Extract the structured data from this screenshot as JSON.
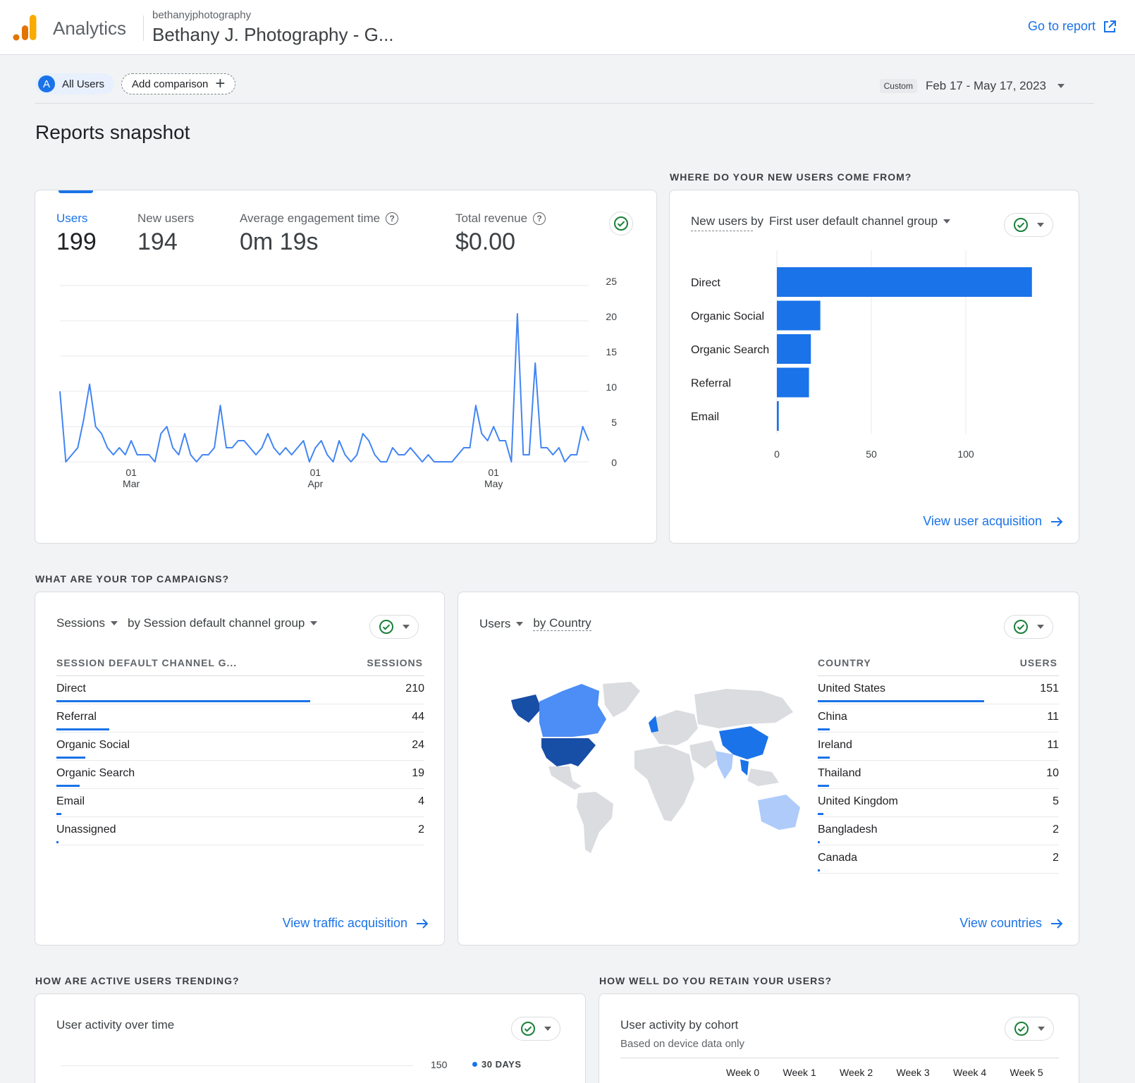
{
  "header": {
    "app_name": "Analytics",
    "account": "bethanyjphotography",
    "property": "Bethany J. Photography - G...",
    "go_to_report": "Go to report"
  },
  "toolbar": {
    "segment_avatar": "A",
    "segment_label": "All Users",
    "add_comparison": "Add comparison",
    "date_tag": "Custom",
    "date_range": "Feb 17 - May 17, 2023"
  },
  "page_title": "Reports snapshot",
  "overview": {
    "metrics": [
      {
        "label": "Users",
        "value": "199"
      },
      {
        "label": "New users",
        "value": "194"
      },
      {
        "label": "Average engagement time",
        "value": "0m 19s"
      },
      {
        "label": "Total revenue",
        "value": "$0.00"
      }
    ],
    "y_ticks": [
      "25",
      "20",
      "15",
      "10",
      "5",
      "0"
    ],
    "x_ticks": [
      {
        "day": "01",
        "month": "Mar"
      },
      {
        "day": "01",
        "month": "Apr"
      },
      {
        "day": "01",
        "month": "May"
      }
    ],
    "colors": {
      "line": "#4285f4"
    }
  },
  "new_users": {
    "section": "WHERE DO YOUR NEW USERS COME FROM?",
    "title_metric": "New users by",
    "title_dim": "First user default channel group",
    "link": "View user acquisition",
    "x_ticks": [
      "0",
      "50",
      "100"
    ]
  },
  "campaigns": {
    "section": "WHAT ARE YOUR TOP CAMPAIGNS?",
    "title_metric": "Sessions",
    "title_dim": "by Session default channel group",
    "col1": "SESSION DEFAULT CHANNEL G...",
    "col2": "SESSIONS",
    "rows": [
      {
        "label": "Direct",
        "value": "210"
      },
      {
        "label": "Referral",
        "value": "44"
      },
      {
        "label": "Organic Social",
        "value": "24"
      },
      {
        "label": "Organic Search",
        "value": "19"
      },
      {
        "label": "Email",
        "value": "4"
      },
      {
        "label": "Unassigned",
        "value": "2"
      }
    ],
    "link": "View traffic acquisition"
  },
  "countries": {
    "title_metric": "Users",
    "title_dim": "by Country",
    "col1": "COUNTRY",
    "col2": "USERS",
    "rows": [
      {
        "label": "United States",
        "value": "151"
      },
      {
        "label": "China",
        "value": "11"
      },
      {
        "label": "Ireland",
        "value": "11"
      },
      {
        "label": "Thailand",
        "value": "10"
      },
      {
        "label": "United Kingdom",
        "value": "5"
      },
      {
        "label": "Bangladesh",
        "value": "2"
      },
      {
        "label": "Canada",
        "value": "2"
      }
    ],
    "link": "View countries",
    "map_colors": {
      "dark": "#174ea6",
      "mid": "#1a73e8",
      "light": "#4c8df6",
      "pale": "#aecbfa",
      "none": "#dadce0"
    }
  },
  "activity": {
    "section": "HOW ARE ACTIVE USERS TRENDING?",
    "title": "User activity over time",
    "tick": "150",
    "legend": "30 DAYS"
  },
  "retention": {
    "section": "HOW WELL DO YOU RETAIN YOUR USERS?",
    "title": "User activity by cohort",
    "subtitle": "Based on device data only",
    "weeks": [
      "Week 0",
      "Week 1",
      "Week 2",
      "Week 3",
      "Week 4",
      "Week 5"
    ]
  },
  "chart_data": [
    {
      "type": "line",
      "title": "Users",
      "ylim": [
        0,
        25
      ],
      "x": [
        "Feb 17",
        "Feb 18",
        "Feb 19",
        "Feb 20",
        "Feb 21",
        "Feb 22",
        "Feb 23",
        "Feb 24",
        "Feb 25",
        "Feb 26",
        "Feb 27",
        "Feb 28",
        "Mar 1",
        "Mar 2",
        "Mar 3",
        "Mar 4",
        "Mar 5",
        "Mar 6",
        "Mar 7",
        "Mar 8",
        "Mar 9",
        "Mar 10",
        "Mar 11",
        "Mar 12",
        "Mar 13",
        "Mar 14",
        "Mar 15",
        "Mar 16",
        "Mar 17",
        "Mar 18",
        "Mar 19",
        "Mar 20",
        "Mar 21",
        "Mar 22",
        "Mar 23",
        "Mar 24",
        "Mar 25",
        "Mar 26",
        "Mar 27",
        "Mar 28",
        "Mar 29",
        "Mar 30",
        "Mar 31",
        "Apr 1",
        "Apr 2",
        "Apr 3",
        "Apr 4",
        "Apr 5",
        "Apr 6",
        "Apr 7",
        "Apr 8",
        "Apr 9",
        "Apr 10",
        "Apr 11",
        "Apr 12",
        "Apr 13",
        "Apr 14",
        "Apr 15",
        "Apr 16",
        "Apr 17",
        "Apr 18",
        "Apr 19",
        "Apr 20",
        "Apr 21",
        "Apr 22",
        "Apr 23",
        "Apr 24",
        "Apr 25",
        "Apr 26",
        "Apr 27",
        "Apr 28",
        "Apr 29",
        "Apr 30",
        "May 1",
        "May 2",
        "May 3",
        "May 4",
        "May 5",
        "May 6",
        "May 7",
        "May 8",
        "May 9",
        "May 10",
        "May 11",
        "May 12",
        "May 13",
        "May 14",
        "May 15",
        "May 16",
        "May 17"
      ],
      "series": [
        {
          "name": "Users",
          "values": [
            10,
            0,
            1,
            2,
            6,
            11,
            5,
            4,
            2,
            1,
            2,
            1,
            3,
            1,
            1,
            1,
            0,
            4,
            5,
            2,
            1,
            4,
            1,
            0,
            1,
            1,
            2,
            8,
            2,
            2,
            3,
            3,
            2,
            1,
            2,
            4,
            2,
            1,
            2,
            1,
            2,
            3,
            0,
            2,
            3,
            1,
            0,
            3,
            1,
            0,
            1,
            4,
            3,
            1,
            0,
            0,
            2,
            1,
            1,
            2,
            1,
            0,
            1,
            0,
            0,
            0,
            0,
            1,
            2,
            2,
            8,
            4,
            3,
            5,
            3,
            3,
            0,
            21,
            1,
            1,
            14,
            2,
            2,
            1,
            2,
            0,
            1,
            1,
            5,
            3
          ]
        }
      ]
    },
    {
      "type": "bar",
      "title": "New users by First user default channel group",
      "categories": [
        "Direct",
        "Organic Social",
        "Organic Search",
        "Referral",
        "Email"
      ],
      "values": [
        135,
        23,
        18,
        17,
        1
      ],
      "xlim": [
        0,
        140
      ]
    },
    {
      "type": "table",
      "title": "Sessions by Session default channel group",
      "categories": [
        "Direct",
        "Referral",
        "Organic Social",
        "Organic Search",
        "Email",
        "Unassigned"
      ],
      "values": [
        210,
        44,
        24,
        19,
        4,
        2
      ]
    },
    {
      "type": "table",
      "title": "Users by Country",
      "categories": [
        "United States",
        "China",
        "Ireland",
        "Thailand",
        "United Kingdom",
        "Bangladesh",
        "Canada"
      ],
      "values": [
        151,
        11,
        11,
        10,
        5,
        2,
        2
      ]
    }
  ]
}
